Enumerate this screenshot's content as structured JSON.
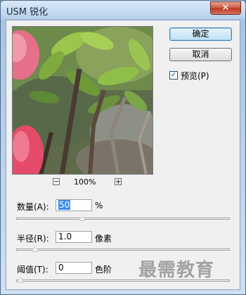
{
  "window": {
    "title": "USM 锐化",
    "close_symbol": "✕"
  },
  "preview": {
    "zoom_out_symbol": "−",
    "zoom_label": "100%",
    "zoom_in_symbol": "+"
  },
  "buttons": {
    "ok": "确定",
    "cancel": "取消"
  },
  "preview_toggle": {
    "label": "预览(P)",
    "checked": true,
    "check_mark": "✓"
  },
  "params": {
    "amount": {
      "label": "数量(A):",
      "value": "50",
      "unit": "%",
      "slider_fraction": 0.29
    },
    "radius": {
      "label": "半径(R):",
      "value": "1.0",
      "unit": "像素",
      "slider_fraction": 0.07
    },
    "threshold": {
      "label": "阈值(T):",
      "value": "0",
      "unit": "色阶",
      "slider_fraction": 0.0
    }
  },
  "watermark": "最需教育"
}
